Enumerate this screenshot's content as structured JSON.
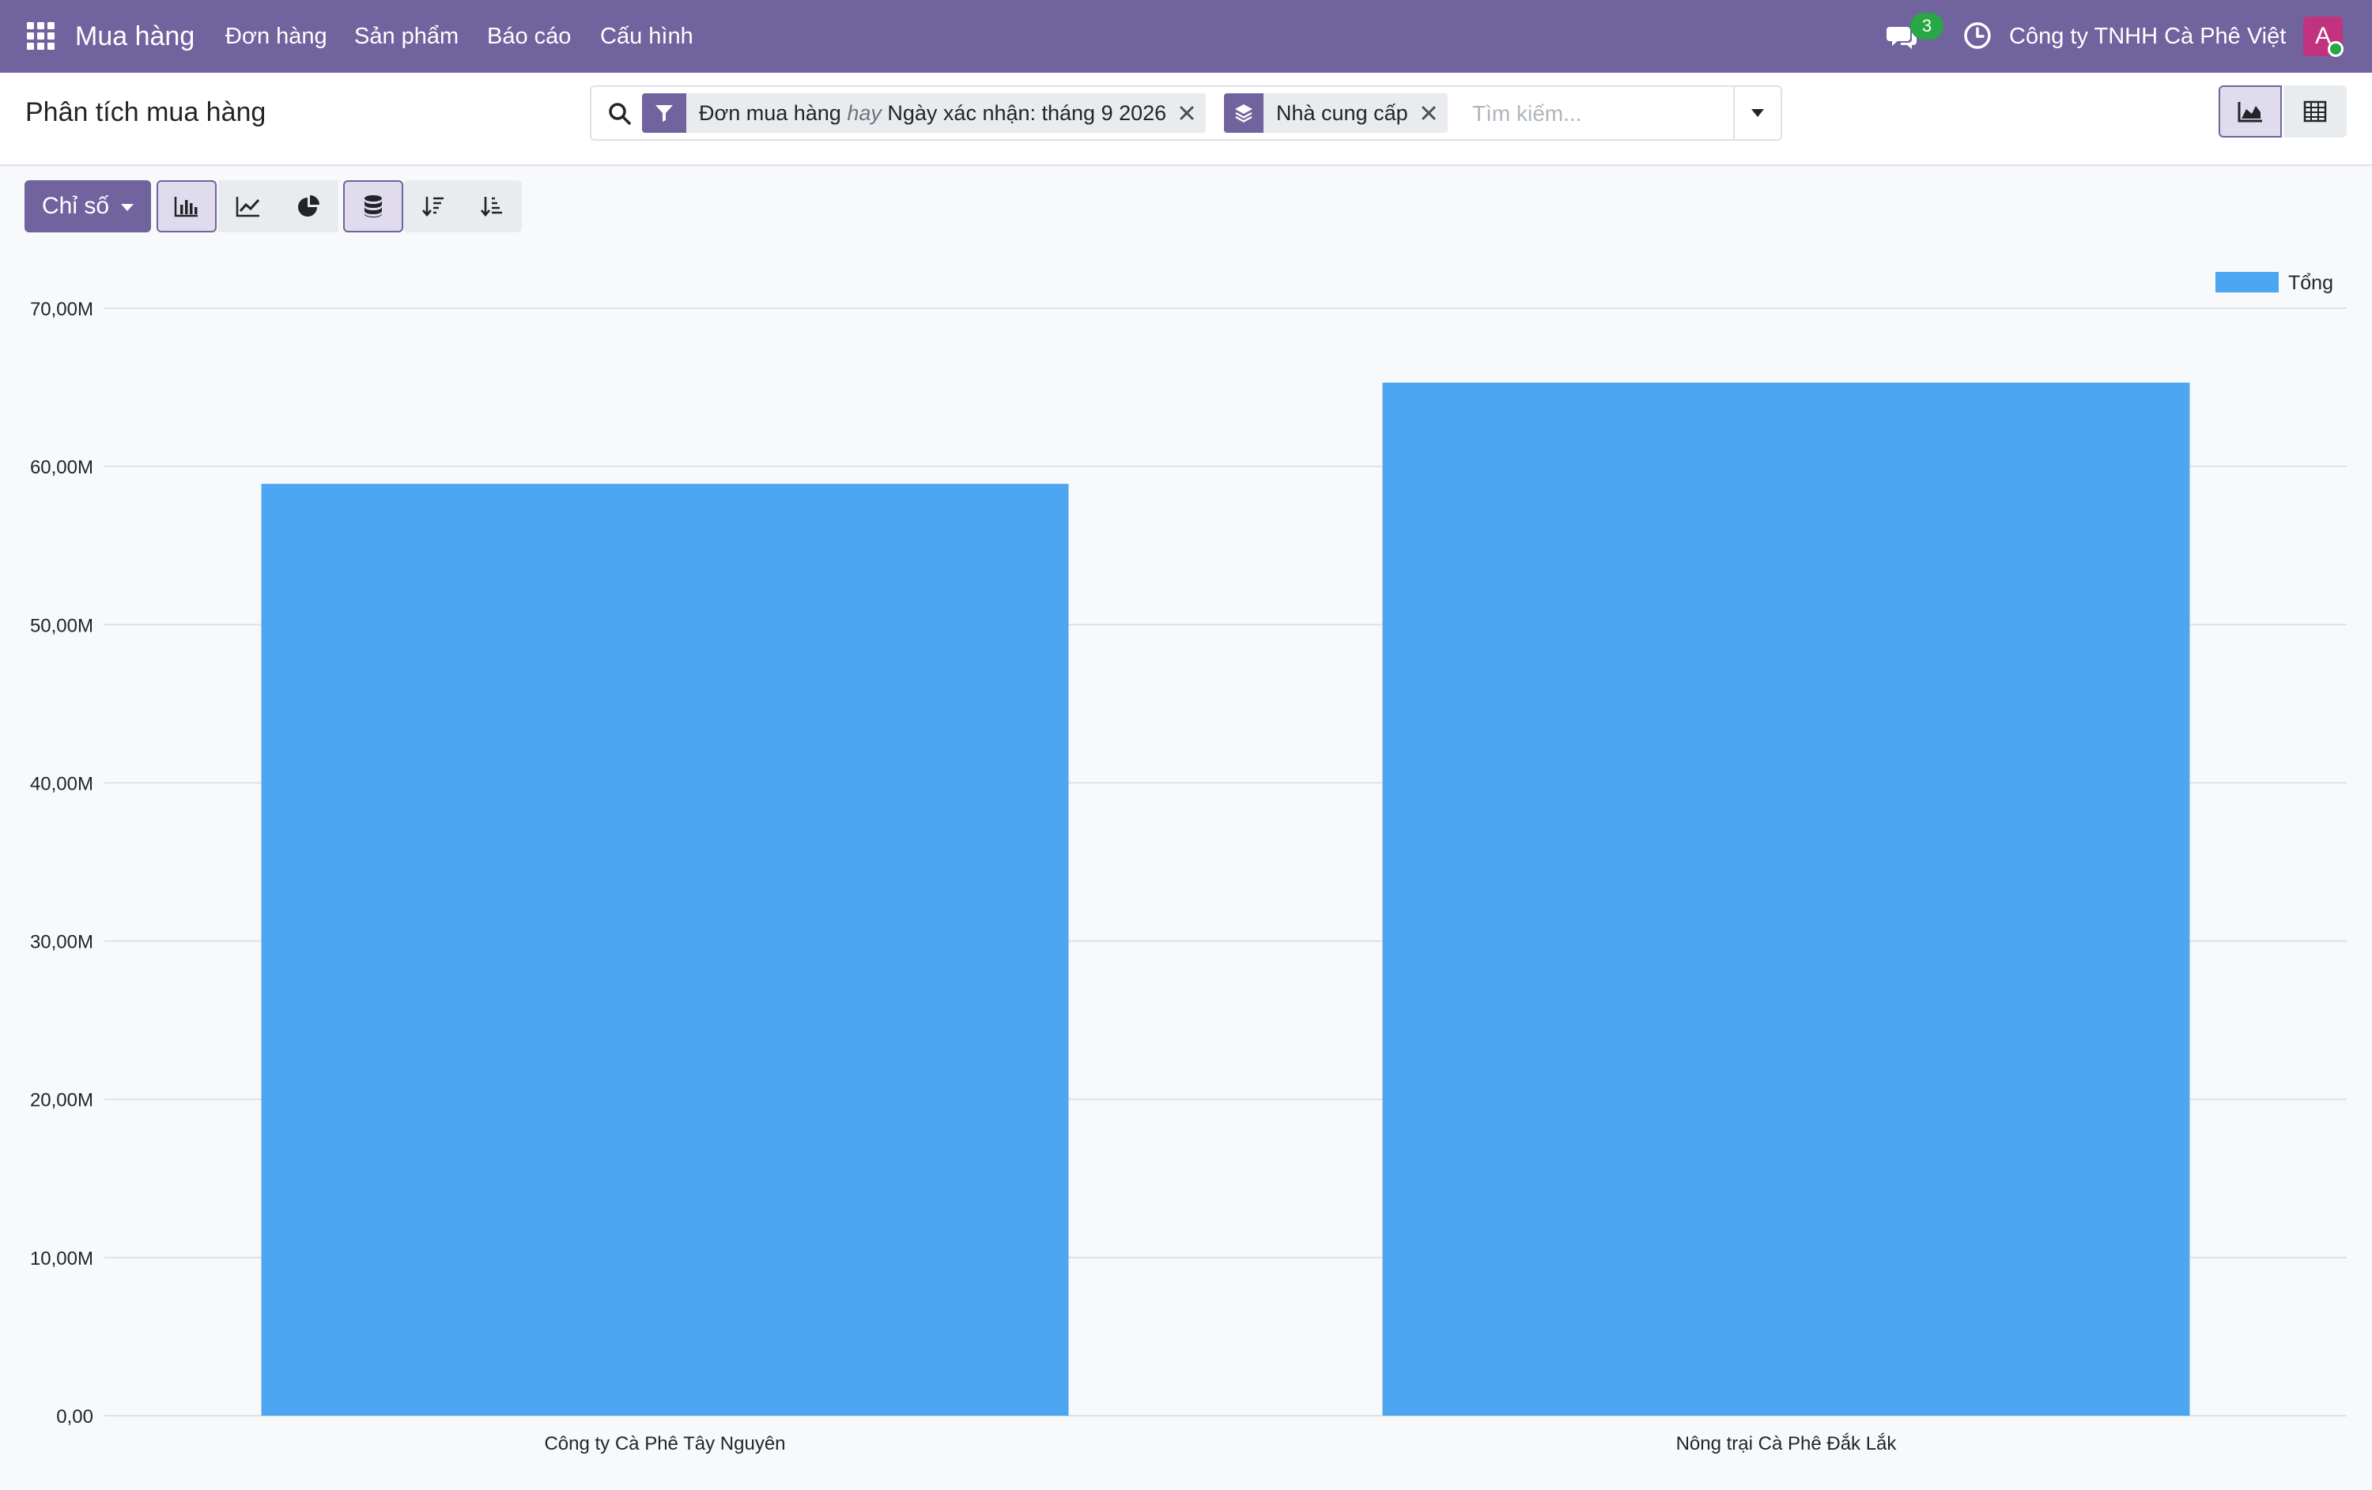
{
  "navbar": {
    "app_name": "Mua hàng",
    "menu": [
      "Đơn hàng",
      "Sản phẩm",
      "Báo cáo",
      "Cấu hình"
    ],
    "chat_badge": "3",
    "company": "Công ty TNHH Cà Phê Việt",
    "avatar_initial": "A",
    "color": "#71639e"
  },
  "control_panel": {
    "title": "Phân tích mua hàng",
    "facets": {
      "filter_part1": "Đơn mua hàng",
      "filter_or": "hay",
      "filter_part2": "Ngày xác nhận: tháng 9 2026",
      "groupby": "Nhà cung cấp"
    },
    "search_placeholder": "Tìm kiếm...",
    "views": {
      "active": "graph",
      "other": "pivot"
    }
  },
  "graph_toolbar": {
    "measures_label": "Chỉ số",
    "active_chart_type": "bar",
    "stacked": true
  },
  "chart_data": {
    "type": "bar",
    "categories": [
      "Công ty Cà Phê Tây Nguyên",
      "Nông trại Cà Phê Đắk Lắk"
    ],
    "series": [
      {
        "name": "Tổng",
        "values": [
          58900000,
          65300000
        ],
        "color": "#4da6f2"
      }
    ],
    "ylim": [
      0,
      70000000
    ],
    "yticks": [
      0,
      10000000,
      20000000,
      30000000,
      40000000,
      50000000,
      60000000,
      70000000
    ],
    "ytick_labels": [
      "0,00",
      "10,00M",
      "20,00M",
      "30,00M",
      "40,00M",
      "50,00M",
      "60,00M",
      "70,00M"
    ],
    "grid": true,
    "legend_position": "top-right"
  }
}
